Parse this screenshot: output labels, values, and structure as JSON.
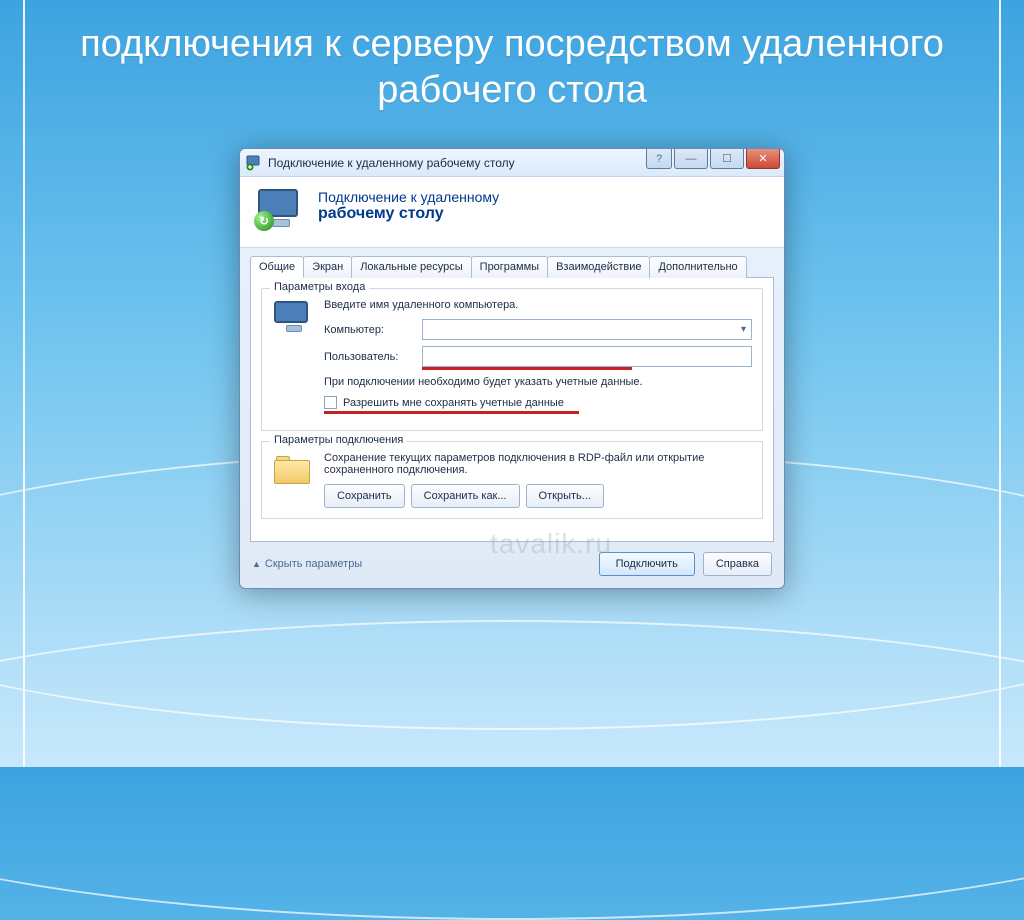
{
  "slide": {
    "title": "подключения к серверу посредством удаленного рабочего стола"
  },
  "window": {
    "title": "Подключение к удаленному рабочему столу",
    "banner": {
      "line1": "Подключение к удаленному",
      "line2": "рабочему столу"
    }
  },
  "tabs": [
    "Общие",
    "Экран",
    "Локальные ресурсы",
    "Программы",
    "Взаимодействие",
    "Дополнительно"
  ],
  "login_group": {
    "title": "Параметры входа",
    "intro": "Введите имя удаленного компьютера.",
    "computer_label": "Компьютер:",
    "computer_value": "",
    "user_label": "Пользователь:",
    "user_value": "",
    "note": "При подключении необходимо будет указать учетные данные.",
    "save_creds_label": "Разрешить мне сохранять учетные данные"
  },
  "conn_group": {
    "title": "Параметры подключения",
    "desc": "Сохранение текущих параметров подключения в RDP-файл или открытие сохраненного подключения.",
    "save": "Сохранить",
    "save_as": "Сохранить как...",
    "open": "Открыть..."
  },
  "footer": {
    "hide": "Скрыть параметры",
    "connect": "Подключить",
    "help": "Справка"
  },
  "watermark": "tavalik.ru"
}
